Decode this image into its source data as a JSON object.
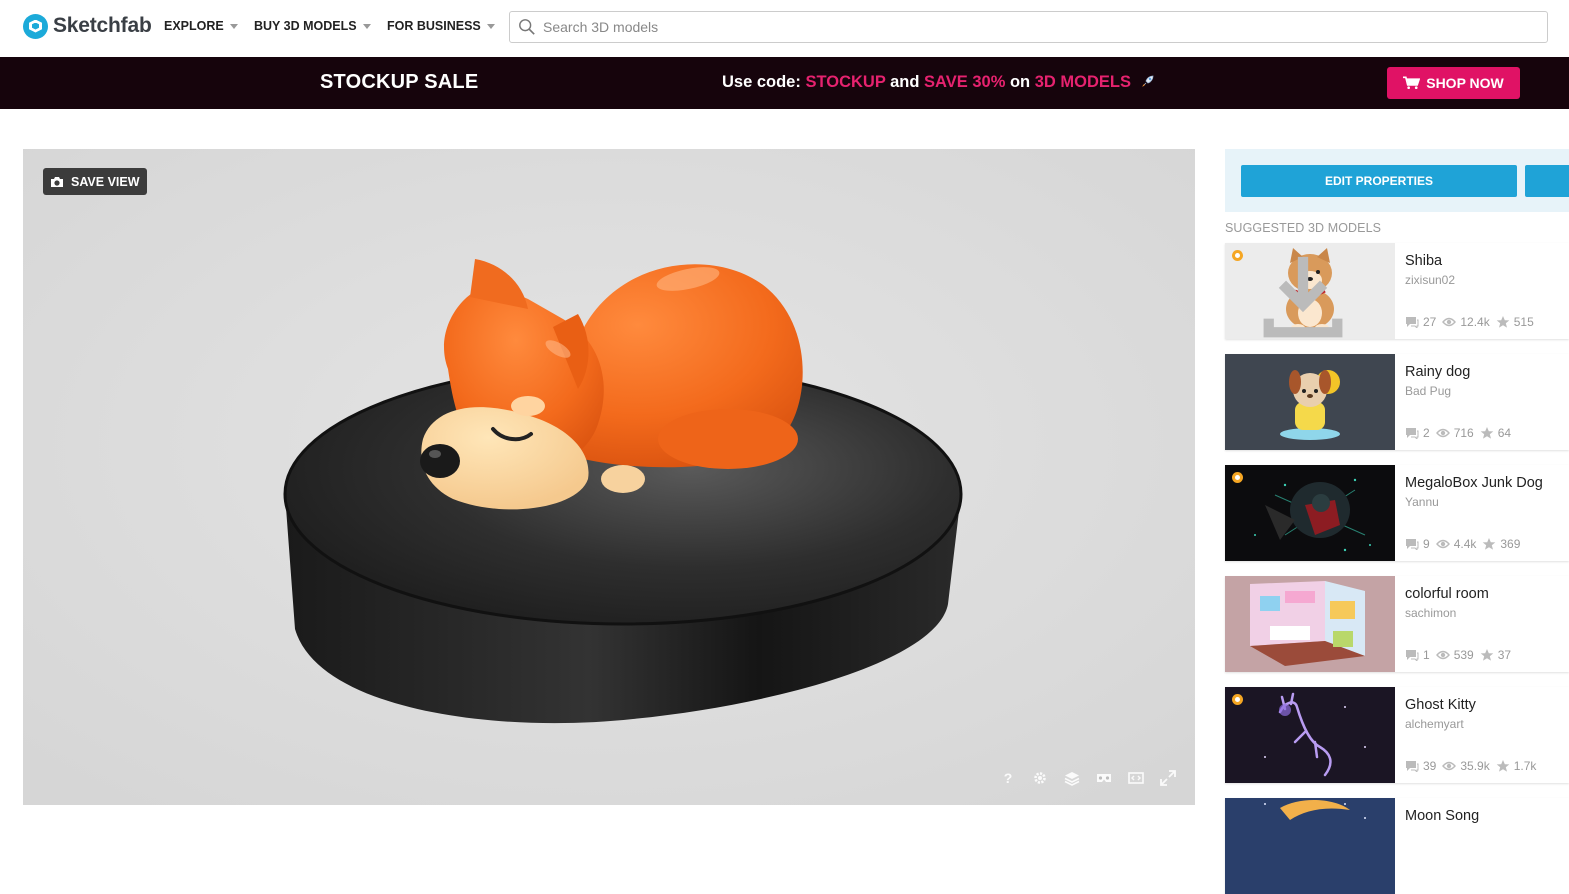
{
  "brand": {
    "name": "Sketchfab",
    "accent": "#1caad9"
  },
  "nav": {
    "items": [
      {
        "label": "EXPLORE"
      },
      {
        "label": "BUY 3D MODELS"
      },
      {
        "label": "FOR BUSINESS"
      }
    ],
    "search": {
      "placeholder": "Search 3D models",
      "value": ""
    }
  },
  "promo": {
    "title": "STOCKUP SALE",
    "segments": [
      {
        "text": "Use code: ",
        "color": "#ffffff"
      },
      {
        "text": "STOCKUP",
        "color": "#e6226f"
      },
      {
        "text": " and ",
        "color": "#ffffff"
      },
      {
        "text": "SAVE 30%",
        "color": "#e6226f"
      },
      {
        "text": " on ",
        "color": "#ffffff"
      },
      {
        "text": "3D MODELS",
        "color": "#e6226f"
      }
    ],
    "rocket_icon": "rocket-icon",
    "button_label": "SHOP NOW",
    "button_color": "#e01265"
  },
  "viewer": {
    "save_view_label": "SAVE VIEW",
    "controls": [
      "help-icon",
      "settings-icon",
      "layers-icon",
      "vr-icon",
      "embed-icon",
      "fullscreen-icon"
    ],
    "help_label": "?"
  },
  "sidebar": {
    "edit_button_label": "EDIT PROPERTIES",
    "suggested_title": "SUGGESTED 3D MODELS",
    "models": [
      {
        "name": "Shiba",
        "author": "zixisun02",
        "comments": "27",
        "views": "12.4k",
        "likes": "515",
        "staff_pick": true,
        "downloadable": true,
        "thumb_bg": "#ececec"
      },
      {
        "name": "Rainy dog",
        "author": "Bad Pug",
        "comments": "2",
        "views": "716",
        "likes": "64",
        "staff_pick": false,
        "downloadable": false,
        "thumb_bg": "#3f4650"
      },
      {
        "name": "MegaloBox Junk Dog",
        "author": "Yannu",
        "comments": "9",
        "views": "4.4k",
        "likes": "369",
        "staff_pick": true,
        "downloadable": false,
        "thumb_bg": "#0c0c0e"
      },
      {
        "name": "colorful room",
        "author": "sachimon",
        "comments": "1",
        "views": "539",
        "likes": "37",
        "staff_pick": false,
        "downloadable": false,
        "thumb_bg": "#c4a3a5"
      },
      {
        "name": "Ghost Kitty",
        "author": "alchemyart",
        "comments": "39",
        "views": "35.9k",
        "likes": "1.7k",
        "staff_pick": true,
        "downloadable": false,
        "thumb_bg": "#1b1524"
      },
      {
        "name": "Moon Song",
        "author": "",
        "comments": "",
        "views": "",
        "likes": "",
        "staff_pick": false,
        "downloadable": false,
        "thumb_bg": "#2a3f6b"
      }
    ]
  }
}
